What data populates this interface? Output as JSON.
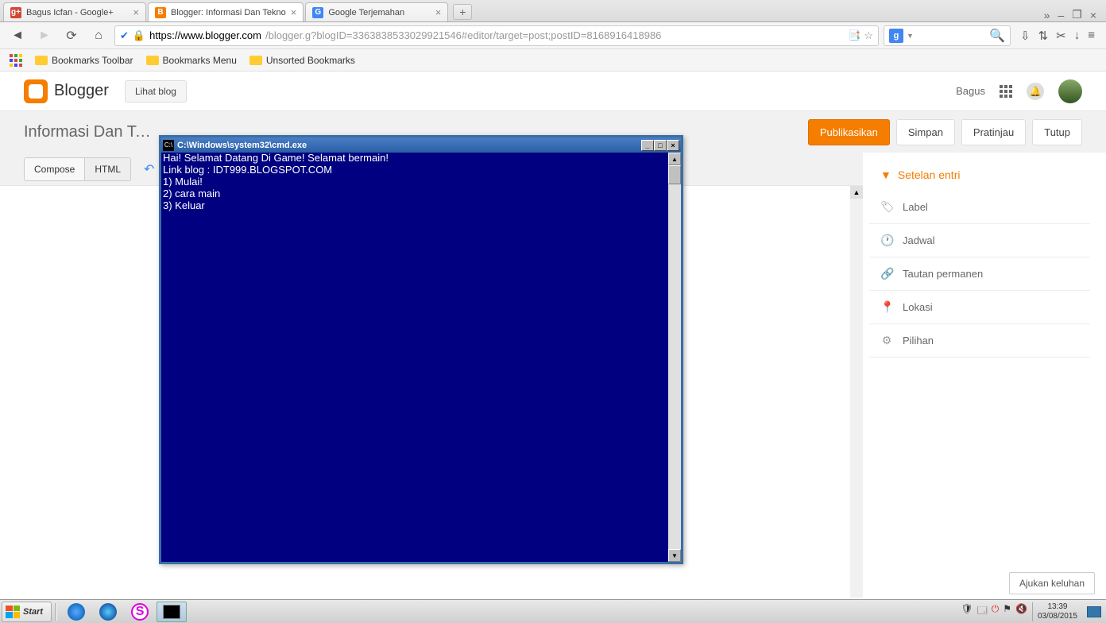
{
  "browser": {
    "tabs": [
      {
        "title": "Bagus Icfan - Google+",
        "favicon": "g+"
      },
      {
        "title": "Blogger: Informasi Dan Tekno",
        "favicon": "B",
        "active": true
      },
      {
        "title": "Google Terjemahan",
        "favicon": "G"
      }
    ],
    "url_host": "https://www.blogger.com",
    "url_rest": "/blogger.g?blogID=3363838533029921546#editor/target=post;postID=8168916418986",
    "window_controls": {
      "overflow": "»",
      "min": "–",
      "max": "❐",
      "close": "×"
    }
  },
  "bookmarks": {
    "toolbar": "Bookmarks Toolbar",
    "menu": "Bookmarks Menu",
    "unsorted": "Unsorted Bookmarks"
  },
  "blogger": {
    "brand": "Blogger",
    "view_blog_btn": "Lihat blog",
    "user": "Bagus",
    "page_title": "Informasi Dan Tek...",
    "buttons": {
      "publish": "Publikasikan",
      "save": "Simpan",
      "preview": "Pratinjau",
      "close": "Tutup",
      "compose": "Compose",
      "html": "HTML"
    },
    "sidebar": {
      "header": "Setelan entri",
      "items": [
        "Label",
        "Jadwal",
        "Tautan permanen",
        "Lokasi",
        "Pilihan"
      ]
    },
    "feedback": "Ajukan keluhan"
  },
  "cmd": {
    "title": "C:\\Windows\\system32\\cmd.exe",
    "lines": [
      "Hai! Selamat Datang Di Game! Selamat bermain!",
      "Link blog : IDT999.BLOGSPOT.COM",
      "1) Mulai!",
      "2) cara main",
      "3) Keluar"
    ]
  },
  "taskbar": {
    "start": "Start",
    "time": "13:39",
    "date": "03/08/2015"
  }
}
